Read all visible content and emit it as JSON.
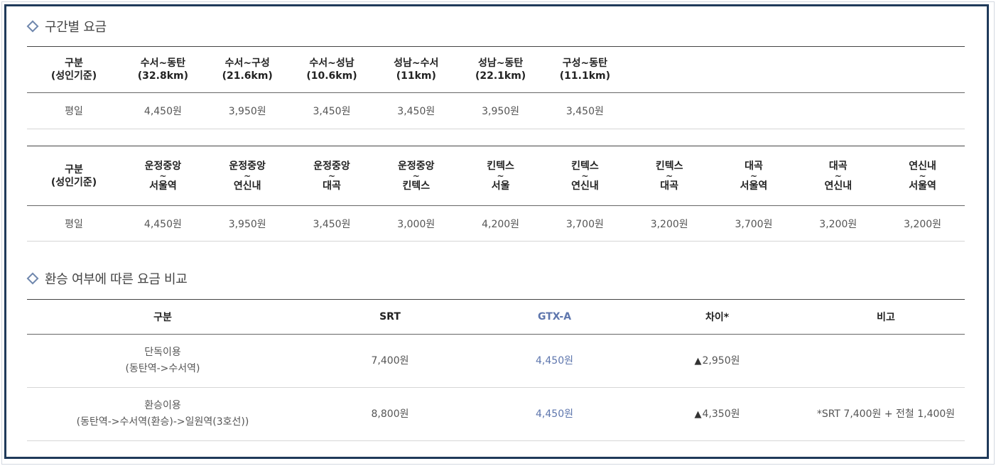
{
  "section1": {
    "title": "구간별 요금",
    "table1": {
      "headers": [
        [
          "구분",
          "(성인기준)"
        ],
        [
          "수서~동탄",
          "(32.8km)"
        ],
        [
          "수서~구성",
          "(21.6km)"
        ],
        [
          "수서~성남",
          "(10.6km)"
        ],
        [
          "성남~수서",
          "(11km)"
        ],
        [
          "성남~동탄",
          "(22.1km)"
        ],
        [
          "구성~동탄",
          "(11.1km)"
        ]
      ],
      "row": [
        "평일",
        "4,450원",
        "3,950원",
        "3,450원",
        "3,450원",
        "3,950원",
        "3,450원"
      ]
    },
    "table2": {
      "headers": [
        [
          "구분",
          "(성인기준)"
        ],
        [
          "운정중앙",
          "~",
          "서울역"
        ],
        [
          "운정중앙",
          "~",
          "연신내"
        ],
        [
          "운정중앙",
          "~",
          "대곡"
        ],
        [
          "운정중앙",
          "~",
          "킨텍스"
        ],
        [
          "킨텍스",
          "~",
          "서울"
        ],
        [
          "킨텍스",
          "~",
          "연신내"
        ],
        [
          "킨텍스",
          "~",
          "대곡"
        ],
        [
          "대곡",
          "~",
          "서울역"
        ],
        [
          "대곡",
          "~",
          "연신내"
        ],
        [
          "연신내",
          "~",
          "서울역"
        ]
      ],
      "row": [
        "평일",
        "4,450원",
        "3,950원",
        "3,450원",
        "3,000원",
        "4,200원",
        "3,700원",
        "3,200원",
        "3,700원",
        "3,200원",
        "3,200원"
      ]
    }
  },
  "section2": {
    "title": "환승 여부에 따른 요금 비교",
    "table": {
      "headers": [
        "구분",
        "SRT",
        "GTX-A",
        "차이*",
        "비고"
      ],
      "rows": [
        {
          "label": [
            "단독이용",
            "(동탄역->수서역)"
          ],
          "srt": "7,400원",
          "gtx": "4,450원",
          "diff": "2,950원",
          "note": ""
        },
        {
          "label": [
            "환승이용",
            "(동탄역->수서역(환승)->일원역(3호선))"
          ],
          "srt": "8,800원",
          "gtx": "4,450원",
          "diff": "4,350원",
          "note": "*SRT 7,400원 + 전철 1,400원"
        }
      ]
    },
    "triangle_glyph": "▲"
  },
  "colors": {
    "frame": "#1f3a5a",
    "accent": "#5e76ad",
    "bullet": "#6f87ad"
  }
}
